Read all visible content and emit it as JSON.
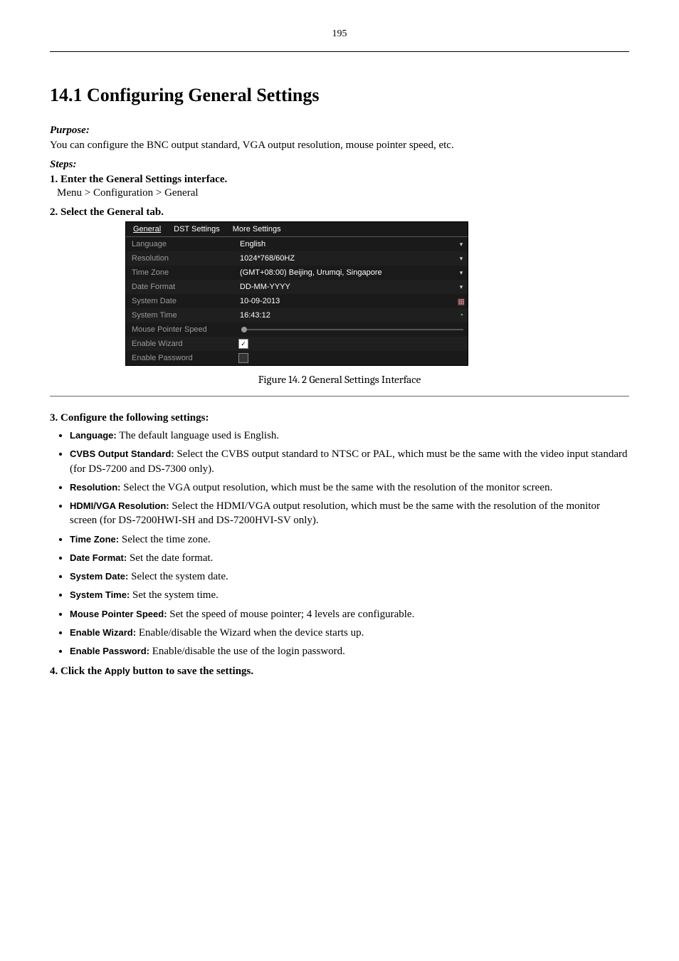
{
  "page_header": {
    "page_number": "195"
  },
  "section": {
    "title": "14.1 Configuring General Settings",
    "purpose_head": "Purpose:",
    "purpose_body": "You can configure the BNC output standard, VGA output resolution, mouse pointer speed, etc.",
    "steps_head": "Steps:",
    "step1": "1. Enter the General Settings interface.",
    "path": "Menu > Configuration > General",
    "step2": "2. Select the General tab.",
    "fig_caption": "Figure 14. 2 General Settings Interface",
    "step3": "3. Configure the following settings:",
    "bullets": [
      {
        "label": "Language:",
        "text": " The default language used is English."
      },
      {
        "label": "CVBS Output Standard:",
        "text": " Select the CVBS output standard to NTSC or PAL, which must be the same with the video input standard (for DS-7200 and DS-7300 only)."
      },
      {
        "label": "Resolution:",
        "text": " Select the VGA output resolution, which must be the same with the resolution of the monitor screen."
      },
      {
        "label": "HDMI/VGA Resolution:",
        "text": " Select the HDMI/VGA output resolution, which must be the same with the resolution of the monitor screen (for DS-7200HWI-SH and DS-7200HVI-SV only)."
      },
      {
        "label": "Time Zone:",
        "text": " Select the time zone."
      },
      {
        "label": "Date Format:",
        "text": " Set the date format."
      },
      {
        "label": "System Date:",
        "text": " Select the system date."
      },
      {
        "label": "System Time:",
        "text": " Set the system time."
      },
      {
        "label": "Mouse Pointer Speed:",
        "text": " Set the speed of mouse pointer; 4 levels are configurable."
      },
      {
        "label": "Enable Wizard:",
        "text": " Enable/disable the Wizard when the device starts up."
      },
      {
        "label": "Enable Password:",
        "text": " Enable/disable the use of the login password."
      }
    ],
    "step4_a": "4. Click the ",
    "apply_btn": "Apply",
    "step4_b": " button to save the settings."
  },
  "ui": {
    "tabs": {
      "general": "General",
      "dst": "DST Settings",
      "more": "More Settings"
    },
    "rows": {
      "language": {
        "label": "Language",
        "value": "English"
      },
      "resolution": {
        "label": "Resolution",
        "value": "1024*768/60HZ"
      },
      "timezone": {
        "label": "Time Zone",
        "value": "(GMT+08:00) Beijing, Urumqi, Singapore"
      },
      "dateformat": {
        "label": "Date Format",
        "value": "DD-MM-YYYY"
      },
      "sysdate": {
        "label": "System Date",
        "value": "10-09-2013"
      },
      "systime": {
        "label": "System Time",
        "value": "16:43:12"
      },
      "mouse": {
        "label": "Mouse Pointer Speed"
      },
      "wizard": {
        "label": "Enable Wizard",
        "checked": true
      },
      "password": {
        "label": "Enable Password",
        "checked": false
      }
    }
  }
}
